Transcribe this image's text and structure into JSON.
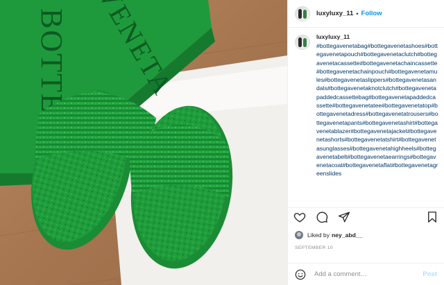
{
  "post": {
    "image_alt": "Green terry slide sandals on a green box",
    "box_text": [
      "BOTTEGA",
      "VENETA"
    ],
    "author": "luxyluxy_11",
    "dot": "•",
    "follow_label": "Follow",
    "caption_user": "luxyluxy_11",
    "caption_text": "#bottegavenetabag#bottegavenetashoes#bottegavenetapouch#bottegavenetaclutch#bottegavenetacassette#bottegavenetachaincassette#bottegavenetachainpouch#bottegavenetamules#bottegavenetaslippers#bottegavenetasandals#bottegavenetaknotclutch#bottegavenetapaddedcassettebag#bottegavenetapaddedcassette#bottegavenetatee#bottegavenetatop#bottegavenetadress#bottegavenetatrousers#bottegavenetapants#bottegavenetashirt#bottegavenetablazer#bottegavenetajacket#bottegavenetashorts#bottegavenetatshirt#bottegavenetasunglasses#bottegavenetahighheels#bottegavenetabelt#bottegavenetaearrings#bottegavenetacoat#bottegavenetaflat#bottegavenetagreenslides",
    "liked_by_prefix": "Liked by",
    "liked_by_user": "ney_abd__",
    "date": "SEPTEMBER 10",
    "comment_placeholder": "Add a comment…",
    "post_label": "Post"
  },
  "icons": [
    "heart-icon",
    "comment-icon",
    "share-icon",
    "bookmark-icon",
    "emoji-icon"
  ],
  "colors": {
    "accent": "#0095f6",
    "post_disabled": "#b2dffc",
    "box_green": "#1e9a3c",
    "slipper_green": "#22a33f"
  }
}
